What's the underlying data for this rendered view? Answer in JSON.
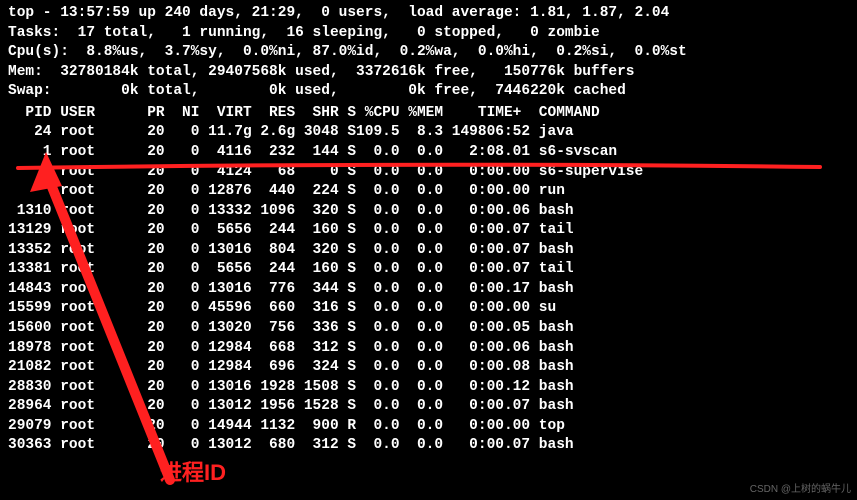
{
  "summary": {
    "line1": "top - 13:57:59 up 240 days, 21:29,  0 users,  load average: 1.81, 1.87, 2.04",
    "line2": "Tasks:  17 total,   1 running,  16 sleeping,   0 stopped,   0 zombie",
    "line3": "Cpu(s):  8.8%us,  3.7%sy,  0.0%ni, 87.0%id,  0.2%wa,  0.0%hi,  0.2%si,  0.0%st",
    "line4": "Mem:  32780184k total, 29407568k used,  3372616k free,   150776k buffers",
    "line5": "Swap:        0k total,        0k used,        0k free,  7446220k cached"
  },
  "columns": "  PID USER      PR  NI  VIRT  RES  SHR S %CPU %MEM    TIME+  COMMAND",
  "processes": [
    {
      "pid": "24",
      "user": "root",
      "pr": "20",
      "ni": "0",
      "virt": "11.7g",
      "res": "2.6g",
      "shr": "3048",
      "s": "S",
      "cpu": "109.5",
      "mem": "8.3",
      "time": "149806:52",
      "cmd": "java"
    },
    {
      "pid": "1",
      "user": "root",
      "pr": "20",
      "ni": "0",
      "virt": "4116",
      "res": "232",
      "shr": "144",
      "s": "S",
      "cpu": "0.0",
      "mem": "0.0",
      "time": "2:08.01",
      "cmd": "s6-svscan"
    },
    {
      "pid": "",
      "user": "root",
      "pr": "20",
      "ni": "0",
      "virt": "4124",
      "res": "68",
      "shr": "0",
      "s": "S",
      "cpu": "0.0",
      "mem": "0.0",
      "time": "0:00.00",
      "cmd": "s6-supervise"
    },
    {
      "pid": "",
      "user": "root",
      "pr": "20",
      "ni": "0",
      "virt": "12876",
      "res": "440",
      "shr": "224",
      "s": "S",
      "cpu": "0.0",
      "mem": "0.0",
      "time": "0:00.00",
      "cmd": "run"
    },
    {
      "pid": "1310",
      "user": "root",
      "pr": "20",
      "ni": "0",
      "virt": "13332",
      "res": "1096",
      "shr": "320",
      "s": "S",
      "cpu": "0.0",
      "mem": "0.0",
      "time": "0:00.06",
      "cmd": "bash"
    },
    {
      "pid": "13129",
      "user": "root",
      "pr": "20",
      "ni": "0",
      "virt": "5656",
      "res": "244",
      "shr": "160",
      "s": "S",
      "cpu": "0.0",
      "mem": "0.0",
      "time": "0:00.07",
      "cmd": "tail"
    },
    {
      "pid": "13352",
      "user": "root",
      "pr": "20",
      "ni": "0",
      "virt": "13016",
      "res": "804",
      "shr": "320",
      "s": "S",
      "cpu": "0.0",
      "mem": "0.0",
      "time": "0:00.07",
      "cmd": "bash"
    },
    {
      "pid": "13381",
      "user": "root",
      "pr": "20",
      "ni": "0",
      "virt": "5656",
      "res": "244",
      "shr": "160",
      "s": "S",
      "cpu": "0.0",
      "mem": "0.0",
      "time": "0:00.07",
      "cmd": "tail"
    },
    {
      "pid": "14843",
      "user": "root",
      "pr": "20",
      "ni": "0",
      "virt": "13016",
      "res": "776",
      "shr": "344",
      "s": "S",
      "cpu": "0.0",
      "mem": "0.0",
      "time": "0:00.17",
      "cmd": "bash"
    },
    {
      "pid": "15599",
      "user": "root",
      "pr": "20",
      "ni": "0",
      "virt": "45596",
      "res": "660",
      "shr": "316",
      "s": "S",
      "cpu": "0.0",
      "mem": "0.0",
      "time": "0:00.00",
      "cmd": "su"
    },
    {
      "pid": "15600",
      "user": "root",
      "pr": "20",
      "ni": "0",
      "virt": "13020",
      "res": "756",
      "shr": "336",
      "s": "S",
      "cpu": "0.0",
      "mem": "0.0",
      "time": "0:00.05",
      "cmd": "bash"
    },
    {
      "pid": "18978",
      "user": "root",
      "pr": "20",
      "ni": "0",
      "virt": "12984",
      "res": "668",
      "shr": "312",
      "s": "S",
      "cpu": "0.0",
      "mem": "0.0",
      "time": "0:00.06",
      "cmd": "bash"
    },
    {
      "pid": "21082",
      "user": "root",
      "pr": "20",
      "ni": "0",
      "virt": "12984",
      "res": "696",
      "shr": "324",
      "s": "S",
      "cpu": "0.0",
      "mem": "0.0",
      "time": "0:00.08",
      "cmd": "bash"
    },
    {
      "pid": "28830",
      "user": "root",
      "pr": "20",
      "ni": "0",
      "virt": "13016",
      "res": "1928",
      "shr": "1508",
      "s": "S",
      "cpu": "0.0",
      "mem": "0.0",
      "time": "0:00.12",
      "cmd": "bash"
    },
    {
      "pid": "28964",
      "user": "root",
      "pr": "20",
      "ni": "0",
      "virt": "13012",
      "res": "1956",
      "shr": "1528",
      "s": "S",
      "cpu": "0.0",
      "mem": "0.0",
      "time": "0:00.07",
      "cmd": "bash"
    },
    {
      "pid": "29079",
      "user": "root",
      "pr": "20",
      "ni": "0",
      "virt": "14944",
      "res": "1132",
      "shr": "900",
      "s": "R",
      "cpu": "0.0",
      "mem": "0.0",
      "time": "0:00.00",
      "cmd": "top"
    },
    {
      "pid": "30363",
      "user": "root",
      "pr": "20",
      "ni": "0",
      "virt": "13012",
      "res": "680",
      "shr": "312",
      "s": "S",
      "cpu": "0.0",
      "mem": "0.0",
      "time": "0:00.07",
      "cmd": "bash"
    }
  ],
  "annotation": {
    "label": "进程ID",
    "watermark": "CSDN @上树的蜗牛儿"
  }
}
